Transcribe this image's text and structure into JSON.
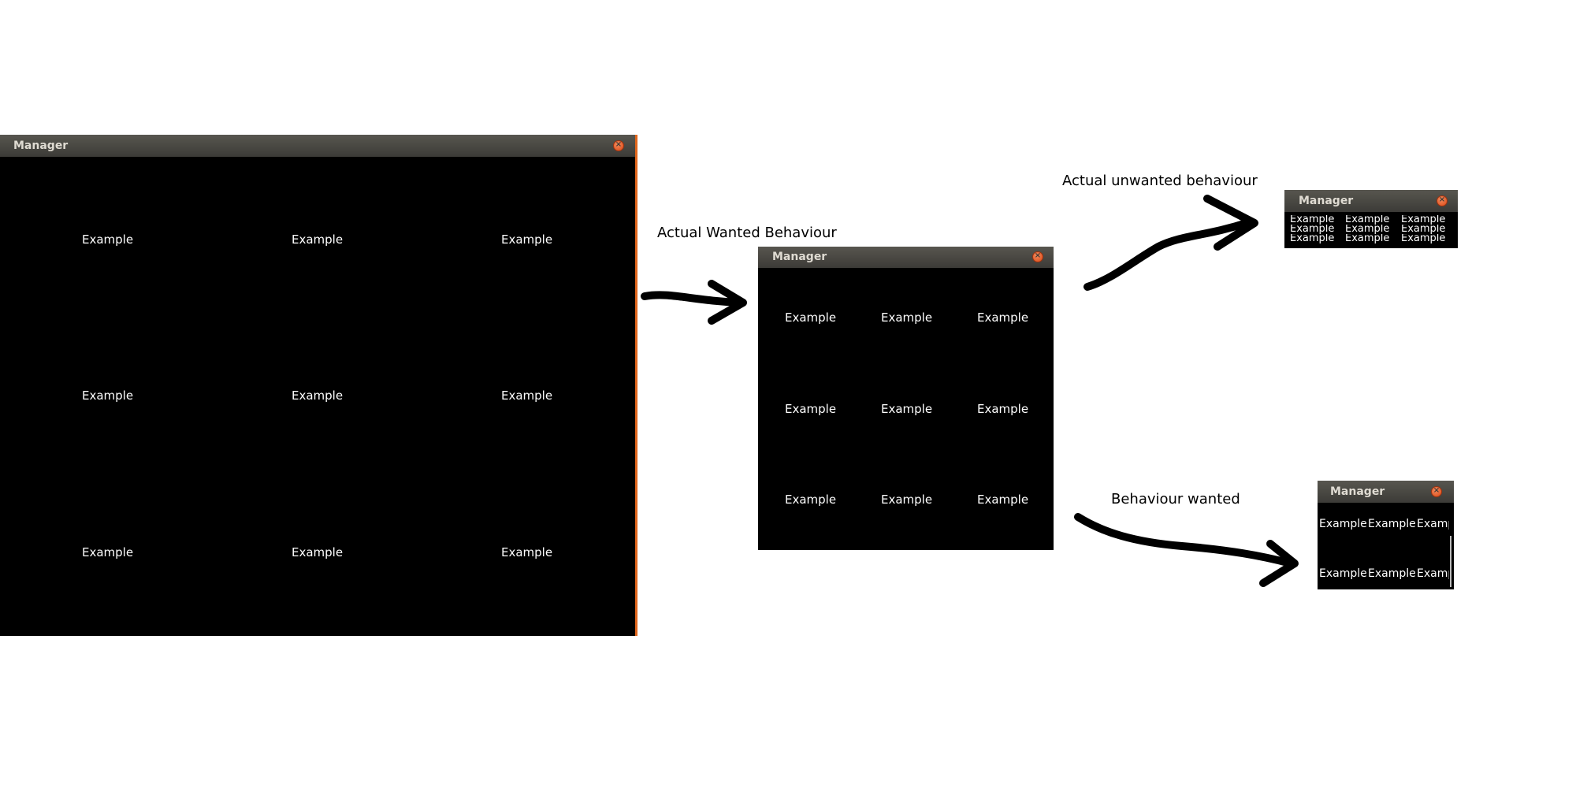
{
  "window_large": {
    "title": "Manager",
    "close_icon": "close-icon",
    "cells": [
      "Example",
      "Example",
      "Example",
      "Example",
      "Example",
      "Example",
      "Example",
      "Example",
      "Example"
    ]
  },
  "window_medium": {
    "title": "Manager",
    "close_icon": "close-icon",
    "cells": [
      "Example",
      "Example",
      "Example",
      "Example",
      "Example",
      "Example",
      "Example",
      "Example",
      "Example"
    ]
  },
  "window_small_unwanted": {
    "title": "Manager",
    "close_icon": "close-icon",
    "cells": [
      "Example",
      "Example",
      "Example",
      "Example",
      "Example",
      "Example",
      "Example",
      "Example",
      "Example"
    ]
  },
  "window_small_wanted": {
    "title": "Manager",
    "close_icon": "close-icon",
    "cells": [
      "Example",
      "Example",
      "Example",
      "Example",
      "Example",
      "Example"
    ]
  },
  "captions": {
    "actual_wanted": "Actual Wanted Behaviour",
    "actual_unwanted": "Actual unwanted behaviour",
    "behaviour_wanted": "Behaviour wanted"
  },
  "colors": {
    "titlebar": "#3c3b37",
    "close": "#dd4814",
    "window_bg": "#000000",
    "accent_edge": "#e0661c"
  }
}
